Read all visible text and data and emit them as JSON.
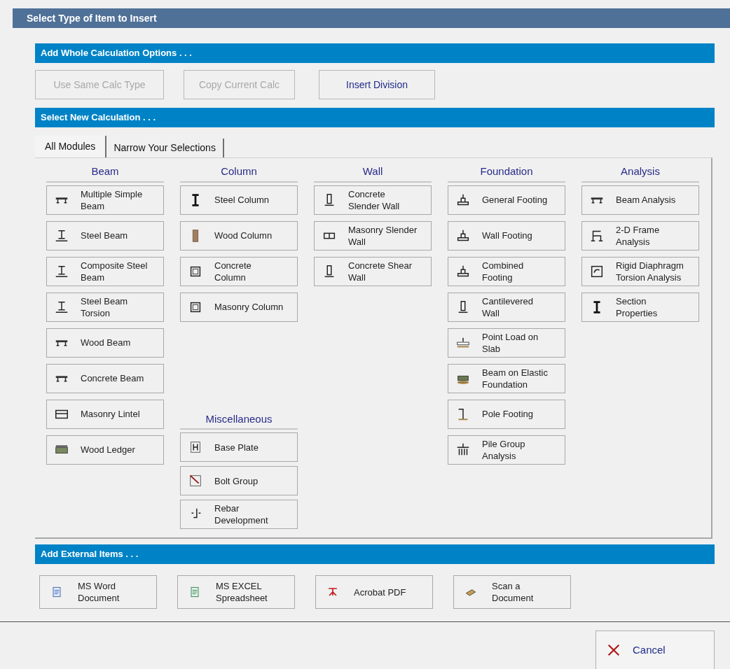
{
  "dialog": {
    "title": "Select Type of Item to Insert"
  },
  "whole_calc": {
    "header": "Add Whole Calculation Options . . .",
    "buttons": [
      {
        "label": "Use Same Calc Type",
        "disabled": true
      },
      {
        "label": "Copy Current Calc",
        "disabled": true
      },
      {
        "label": "Insert Division",
        "disabled": false
      }
    ]
  },
  "new_calc": {
    "header": "Select New Calculation . . .",
    "tabs": [
      {
        "label": "All Modules",
        "selected": true
      },
      {
        "label": "Narrow Your Selections",
        "selected": false
      }
    ],
    "columns": [
      [
        {
          "title": "Beam",
          "items": [
            "Multiple Simple Beam",
            "Steel Beam",
            "Composite Steel Beam",
            "Steel Beam Torsion",
            "Wood Beam",
            "Concrete Beam",
            "Masonry Lintel",
            "Wood Ledger"
          ]
        }
      ],
      [
        {
          "title": "Column",
          "items": [
            "Steel Column",
            "Wood Column",
            "Concrete Column",
            "Masonry Column"
          ]
        },
        {
          "title": "Miscellaneous",
          "items": [
            "Base Plate",
            "Bolt Group",
            "Rebar Development"
          ]
        }
      ],
      [
        {
          "title": "Wall",
          "items": [
            "Concrete Slender Wall",
            "Masonry Slender Wall",
            "Concrete Shear Wall"
          ]
        }
      ],
      [
        {
          "title": "Foundation",
          "items": [
            "General Footing",
            "Wall Footing",
            "Combined Footing",
            "Cantilevered Wall",
            "Point Load on Slab",
            "Beam on Elastic Foundation",
            "Pole Footing",
            "Pile Group Analysis"
          ]
        }
      ],
      [
        {
          "title": "Analysis",
          "items": [
            "Beam Analysis",
            "2-D Frame Analysis",
            "Rigid Diaphragm Torsion Analysis",
            "Section Properties"
          ]
        }
      ]
    ]
  },
  "external": {
    "header": "Add External Items . . .",
    "buttons": [
      "MS Word Document",
      "MS EXCEL Spreadsheet",
      "Acrobat PDF",
      "Scan a Document"
    ]
  },
  "cancel_button": "Cancel"
}
